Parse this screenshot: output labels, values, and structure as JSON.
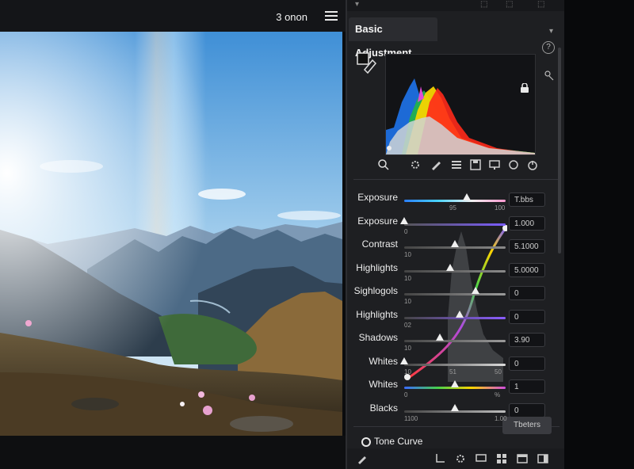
{
  "canvas": {
    "zoom_label": "3 onon",
    "menu_icon": "hamburger-menu-icon"
  },
  "panel": {
    "tab_title": "Basic Adjustment",
    "top_strip_glyphs": [
      "▾",
      "⬚",
      "⬚",
      "⬚"
    ],
    "help_glyph": "?",
    "icons": {
      "swatch": "color-swatch-icon",
      "lock": "lock-icon",
      "side": "camera-icon",
      "toolbar": [
        "search-icon",
        "gear-icon",
        "brush-icon",
        "sliders-icon",
        "save-icon",
        "monitor-icon",
        "circle-icon",
        "power-icon"
      ]
    },
    "adjustments": [
      {
        "label": "Exposure",
        "value": "T.bbs",
        "ticks": [
          "",
          "95",
          "100"
        ],
        "level": 0.62
      },
      {
        "label": "Exposure",
        "value": "1.000",
        "ticks": [
          "0"
        ],
        "level": 0.0
      },
      {
        "label": "Contrast",
        "value": "5.1000",
        "ticks": [
          "10"
        ],
        "level": 0.5
      },
      {
        "label": "Highlights",
        "value": "5.0000",
        "ticks": [
          "10"
        ],
        "level": 0.45
      },
      {
        "label": "Sighlogols",
        "value": "0",
        "ticks": [
          "10"
        ],
        "level": 0.7
      },
      {
        "label": "Highlights",
        "value": "0",
        "ticks": [
          "02"
        ],
        "level": 0.55
      },
      {
        "label": "Shadows",
        "value": "3.90",
        "ticks": [
          "10"
        ],
        "level": 0.35
      },
      {
        "label": "Whites",
        "value": "0",
        "ticks": [
          "10",
          "51",
          "50"
        ],
        "level": 0.0
      },
      {
        "label": "Whites",
        "value": "1",
        "ticks": [
          "0",
          "%"
        ],
        "level": 0.5
      },
      {
        "label": "Blacks",
        "value": "0",
        "ticks": [
          "1100",
          "1.00"
        ],
        "level": 0.5
      }
    ],
    "footer": {
      "tone_curve_label": "Tone Curve",
      "button_label": "Tbeters"
    },
    "bottom_icons": [
      "brush-icon",
      "crop-icon",
      "gear-icon",
      "monitor-icon",
      "grid-icon",
      "layers-icon",
      "window-icon",
      "panel-icon"
    ]
  }
}
